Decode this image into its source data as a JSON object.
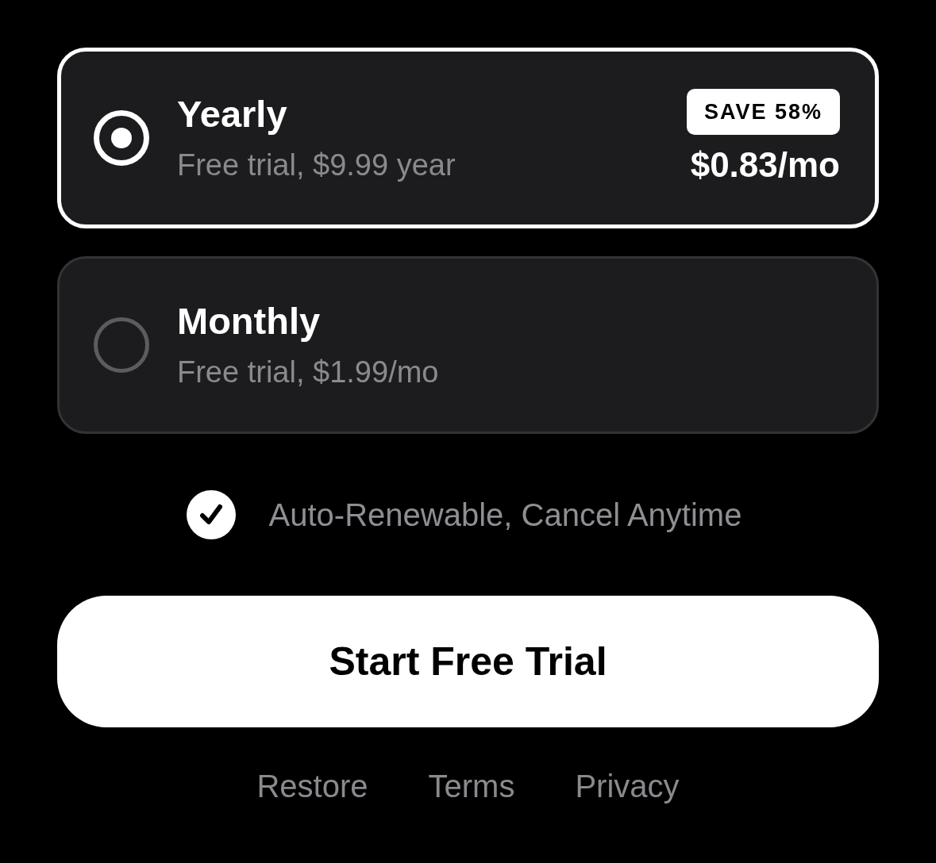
{
  "plans": [
    {
      "name": "Yearly",
      "detail": "Free trial, $9.99 year",
      "badge": "SAVE 58%",
      "price": "$0.83/mo",
      "selected": true
    },
    {
      "name": "Monthly",
      "detail": "Free trial, $1.99/mo",
      "selected": false
    }
  ],
  "auto_renew": {
    "label": "Auto-Renewable, Cancel Anytime",
    "checked": true
  },
  "cta": "Start Free Trial",
  "footer_links": [
    "Restore",
    "Terms",
    "Privacy"
  ]
}
